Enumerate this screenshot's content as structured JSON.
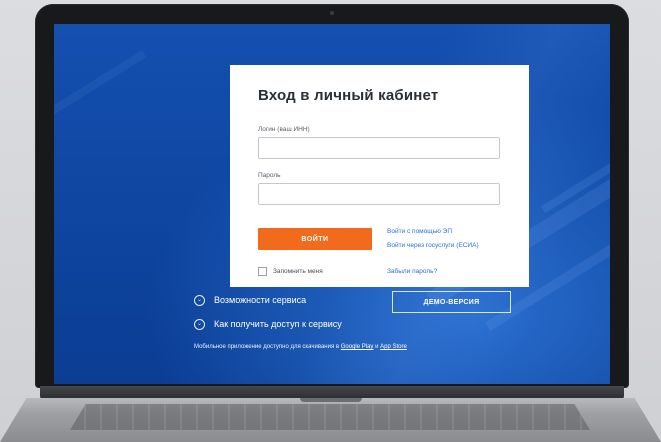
{
  "login_card": {
    "title": "Вход в личный кабинет",
    "login_label": "Логин (ваш ИНН)",
    "login_value": "",
    "password_label": "Пароль",
    "password_value": "",
    "login_button": "ВОЙТИ",
    "link_ep": "Войти с помощью ЭП",
    "link_esia": "Войти через госуслуги (ЕСИА)",
    "remember_label": "Запомнить меня",
    "forgot_link": "Забыли пароль?"
  },
  "service": {
    "features": "Возможности сервиса",
    "access": "Как получить доступ к сервису",
    "demo_button": "ДЕМО-ВЕРСИЯ"
  },
  "mobile": {
    "text": "Мобильное приложение доступно для скачивания в",
    "google_play": "Google Play",
    "and": "и",
    "app_store": "App Store"
  },
  "icons": {
    "expand": "chevron-down-icon"
  },
  "colors": {
    "accent": "#f26a1b",
    "link": "#2b6fd6",
    "screen_bg": "#0f47a3"
  }
}
